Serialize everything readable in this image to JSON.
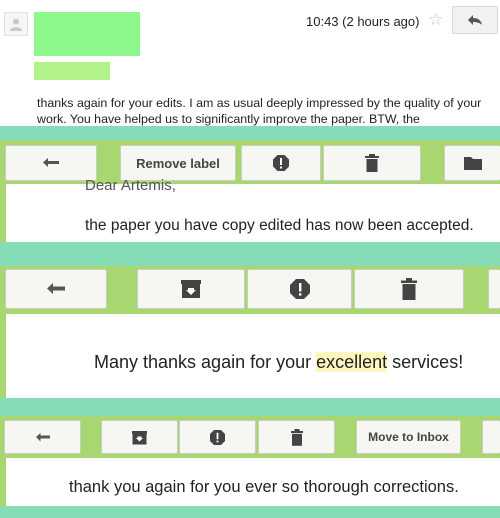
{
  "message_header": {
    "timestamp": "10:43 (2 hours ago)",
    "body": "thanks again for your edits. I am as usual deeply impressed by the quality of your work. You have helped us to significantly improve the paper. BTW, the"
  },
  "toolbar1": {
    "remove_label": "Remove label"
  },
  "message2": {
    "greeting_partial": "Dear Artemis,",
    "body": "the paper you have copy edited has now been accepted."
  },
  "message3": {
    "body_before": "Many thanks again for your ",
    "body_highlight": "excellent",
    "body_after": " services!"
  },
  "toolbar3": {
    "move_to_inbox": "Move to Inbox"
  },
  "message4": {
    "body": "thank you again for you ever so thorough corrections."
  },
  "colors": {
    "divider": "#86dcb7",
    "toolbar_bg": "#a8d670",
    "redacted_sender": "#8ef88c"
  }
}
